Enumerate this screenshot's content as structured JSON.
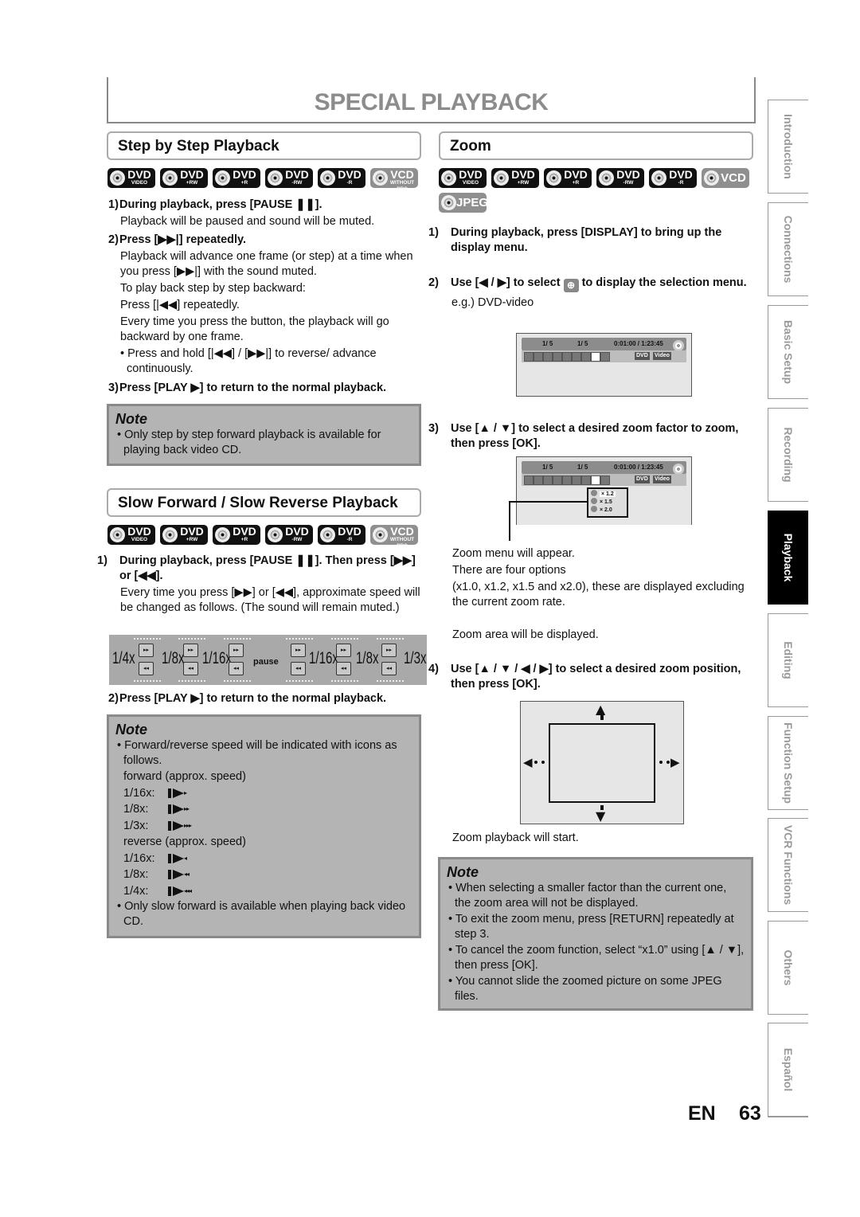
{
  "page": {
    "title": "SPECIAL PLAYBACK",
    "lang": "EN",
    "number": "63"
  },
  "badges_step": [
    {
      "top": "DVD",
      "sub": "VIDEO",
      "style": "black"
    },
    {
      "top": "DVD",
      "sub": "+RW",
      "style": "black"
    },
    {
      "top": "DVD",
      "sub": "+R",
      "style": "black"
    },
    {
      "top": "DVD",
      "sub": "-RW",
      "style": "black"
    },
    {
      "top": "DVD",
      "sub": "-R",
      "style": "black"
    },
    {
      "top": "VCD",
      "sub": "WITHOUT PBC",
      "style": "gray"
    }
  ],
  "badges_zoom": [
    {
      "top": "DVD",
      "sub": "VIDEO",
      "style": "black"
    },
    {
      "top": "DVD",
      "sub": "+RW",
      "style": "black"
    },
    {
      "top": "DVD",
      "sub": "+R",
      "style": "black"
    },
    {
      "top": "DVD",
      "sub": "-RW",
      "style": "black"
    },
    {
      "top": "DVD",
      "sub": "-R",
      "style": "black"
    },
    {
      "top": "VCD",
      "sub": "",
      "style": "gray"
    },
    {
      "top": "JPEG",
      "sub": "",
      "style": "gray"
    }
  ],
  "step_by_step": {
    "heading": "Step by Step Playback",
    "s1_num": "1)",
    "s1": "During playback, press [PAUSE ❚❚].",
    "s1_desc": "Playback will be paused and sound will be muted.",
    "s2_num": "2)",
    "s2": "Press [▶▶|] repeatedly.",
    "s2_desc1": "Playback will advance one frame (or step) at a time when you press [▶▶|] with the sound muted.",
    "s2_desc2": "To play back step by step backward:",
    "s2_desc3": "Press [|◀◀] repeatedly.",
    "s2_desc4": "Every time you press the button, the playback will go backward by one frame.",
    "s2_bullet": "• Press and hold [|◀◀] / [▶▶|] to reverse/ advance continuously.",
    "s3_num": "3)",
    "s3": "Press [PLAY ▶] to return to the normal playback.",
    "note_title": "Note",
    "note_items": [
      "• Only step by step forward playback is available for playing back video CD."
    ]
  },
  "slow": {
    "heading": "Slow Forward / Slow Reverse Playback",
    "s1_num": "1)",
    "s1": "During playback, press [PAUSE ❚❚]. Then press [▶▶] or [◀◀].",
    "s1_desc": "Every time you press [▶▶] or [◀◀], approximate speed will be changed as follows. (The sound will remain muted.)",
    "speeds": [
      "1/4x",
      "1/8x",
      "1/16x",
      "pause",
      "1/16x",
      "1/8x",
      "1/3x"
    ],
    "s2_num": "2)",
    "s2": "Press [PLAY ▶] to return to the normal playback.",
    "note_title": "Note",
    "note_item1": "• Forward/reverse speed will be indicated with icons as follows.",
    "forward_label": "forward (approx. speed)",
    "forward": [
      {
        "label": "1/16x:",
        "mini": "▸"
      },
      {
        "label": "1/8x:",
        "mini": "▸▸"
      },
      {
        "label": "1/3x:",
        "mini": "▸▸▸"
      }
    ],
    "reverse_label": "reverse (approx. speed)",
    "reverse": [
      {
        "label": "1/16x:",
        "mini": "◂"
      },
      {
        "label": "1/8x:",
        "mini": "◂◂"
      },
      {
        "label": "1/4x:",
        "mini": "◂◂◂"
      }
    ],
    "note_item2": "• Only slow forward is available when playing back video CD."
  },
  "zoom": {
    "heading": "Zoom",
    "s1_num": "1)",
    "s1": "During playback, press [DISPLAY] to bring up the display menu.",
    "s2_num": "2)",
    "s2_pre": "Use [◀ / ▶] to select",
    "s2_post": "to display the selection menu.",
    "s2_eg": "e.g.) DVD-video",
    "screen": {
      "chapter": "1/  5",
      "title": "1/  5",
      "time": "0:01:00 / 1:23:45",
      "tag1": "DVD",
      "tag2": "Video"
    },
    "s3_num": "3)",
    "s3": "Use [▲ / ▼] to select a desired zoom factor to zoom, then press [OK].",
    "zoom_options": [
      "× 1.2",
      "× 1.5",
      "× 2.0"
    ],
    "s3_desc1": "Zoom menu will appear.",
    "s3_desc2": "There are four options",
    "s3_desc3": "(x1.0, x1.2, x1.5 and x2.0), these are displayed excluding the current zoom rate.",
    "s3_desc4": "Zoom area will be displayed.",
    "s4_num": "4)",
    "s4": "Use [▲ / ▼ / ◀ / ▶] to select a desired zoom position, then press [OK].",
    "s4_desc": "Zoom playback will start.",
    "note_title": "Note",
    "note_items": [
      "• When selecting a smaller factor than the current one, the zoom area will not be displayed.",
      "• To exit the zoom menu, press [RETURN] repeatedly at step 3.",
      "• To cancel the zoom function, select “x1.0” using [▲ / ▼], then press [OK].",
      "• You cannot slide the zoomed picture on some JPEG files."
    ]
  },
  "side_tabs": [
    {
      "label": "Introduction",
      "active": false
    },
    {
      "label": "Connections",
      "active": false
    },
    {
      "label": "Basic Setup",
      "active": false
    },
    {
      "label": "Recording",
      "active": false
    },
    {
      "label": "Playback",
      "active": true
    },
    {
      "label": "Editing",
      "active": false
    },
    {
      "label": "Function Setup",
      "active": false
    },
    {
      "label": "VCR Functions",
      "active": false
    },
    {
      "label": "Others",
      "active": false
    },
    {
      "label": "Español",
      "active": false
    }
  ]
}
